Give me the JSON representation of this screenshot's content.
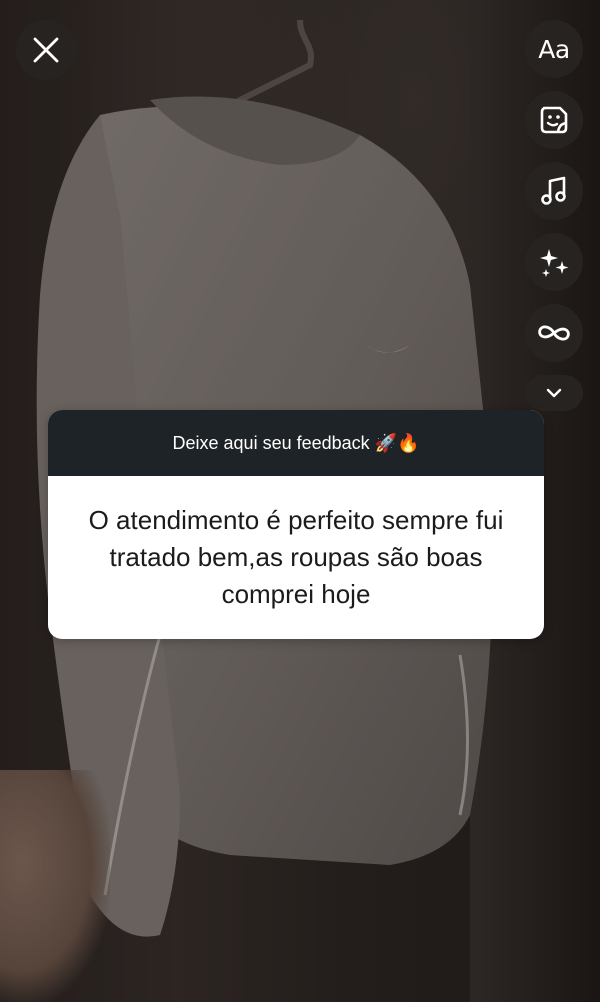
{
  "story_editor": {
    "close_icon": "close-icon",
    "tools": [
      {
        "name": "text-tool",
        "label": "Aa",
        "icon": "text-icon"
      },
      {
        "name": "sticker-tool",
        "icon": "sticker-icon"
      },
      {
        "name": "music-tool",
        "icon": "music-note-icon"
      },
      {
        "name": "effects-tool",
        "icon": "sparkles-icon"
      },
      {
        "name": "boomerang-tool",
        "icon": "infinity-icon"
      },
      {
        "name": "more-tools",
        "icon": "chevron-down-icon"
      }
    ]
  },
  "question_sticker": {
    "prompt": "Deixe aqui seu feedback 🚀🔥",
    "answer": "O atendimento é perfeito sempre fui tratado bem,as roupas são boas comprei hoje"
  },
  "colors": {
    "sticker_header": "#1d2326",
    "sticker_body": "#ffffff",
    "control_bg": "#28241f"
  }
}
